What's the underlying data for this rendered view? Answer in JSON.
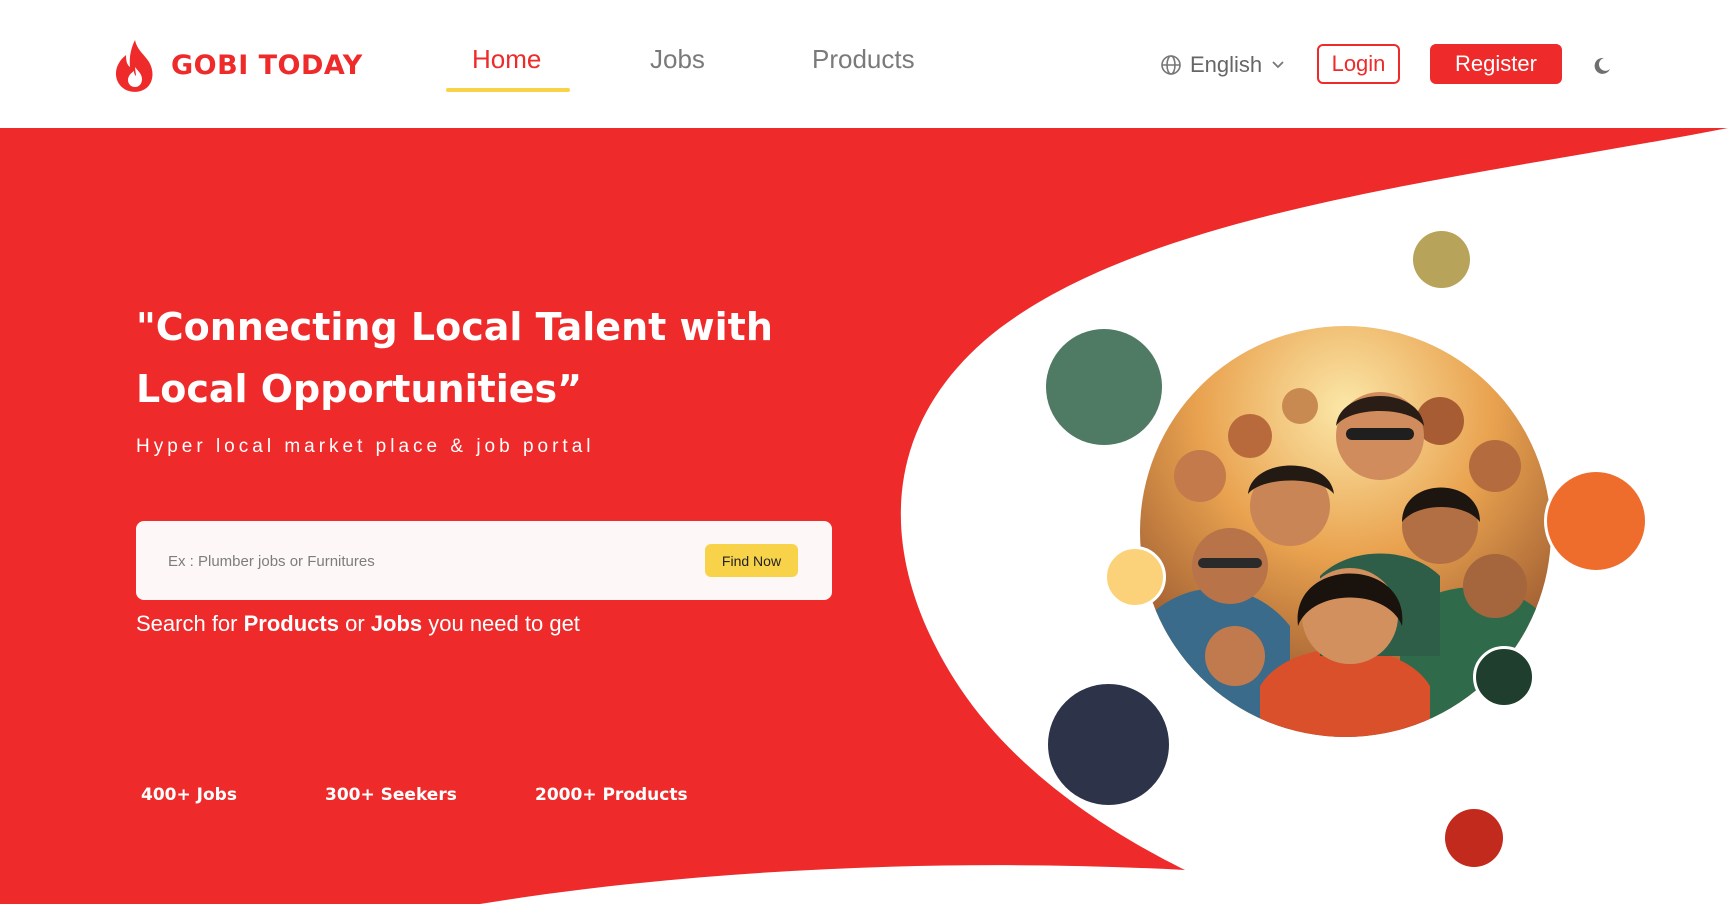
{
  "brand": {
    "name": "GOBI TODAY",
    "color": "#ee2a2a"
  },
  "nav": {
    "items": [
      {
        "label": "Home",
        "active": true
      },
      {
        "label": "Jobs",
        "active": false
      },
      {
        "label": "Products",
        "active": false
      }
    ],
    "active_indicator_color": "#f8d34a"
  },
  "header": {
    "language": {
      "label": "English",
      "icon": "globe-icon"
    },
    "login_label": "Login",
    "register_label": "Register",
    "theme_icon": "moon-icon"
  },
  "hero": {
    "headline_line1": "\"Connecting Local Talent with",
    "headline_line2": "Local Opportunities”",
    "subtitle": "Hyper local market place & job portal",
    "search": {
      "placeholder": "Ex : Plumber jobs or Furnitures",
      "value": "",
      "button_label": "Find Now"
    },
    "helper": {
      "pre": "Search for ",
      "products": "Products",
      "mid": " or ",
      "jobs": "Jobs",
      "post": " you need to get"
    },
    "stats": {
      "jobs": "400+ Jobs",
      "seekers": "300+ Seekers",
      "products": "2000+ Products"
    }
  },
  "colors": {
    "primary": "#ee2a2a",
    "accent": "#f8d34a",
    "decor_dots": [
      "#b7a35a",
      "#4f7a64",
      "#ef6d2c",
      "#fbd27a",
      "#2d3449",
      "#1f3e2e",
      "#c12a1c"
    ]
  },
  "illustration": {
    "subject": "crowd-portrait-illustration"
  }
}
